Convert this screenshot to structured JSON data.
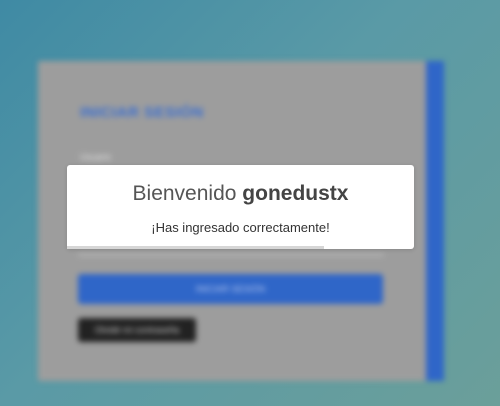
{
  "login": {
    "title": "INICIAR SESIÓN",
    "field_label": "Usuario",
    "submit_label": "INICIAR SESIÓN",
    "secondary_label": "Olvidé mi contraseña"
  },
  "modal": {
    "greeting": "Bienvenido",
    "username": "gonedustx",
    "message": "¡Has ingresado correctamente!",
    "timer_progress": 0.74
  },
  "colors": {
    "accent": "#2f66c8",
    "card": "#9d9d9d"
  }
}
